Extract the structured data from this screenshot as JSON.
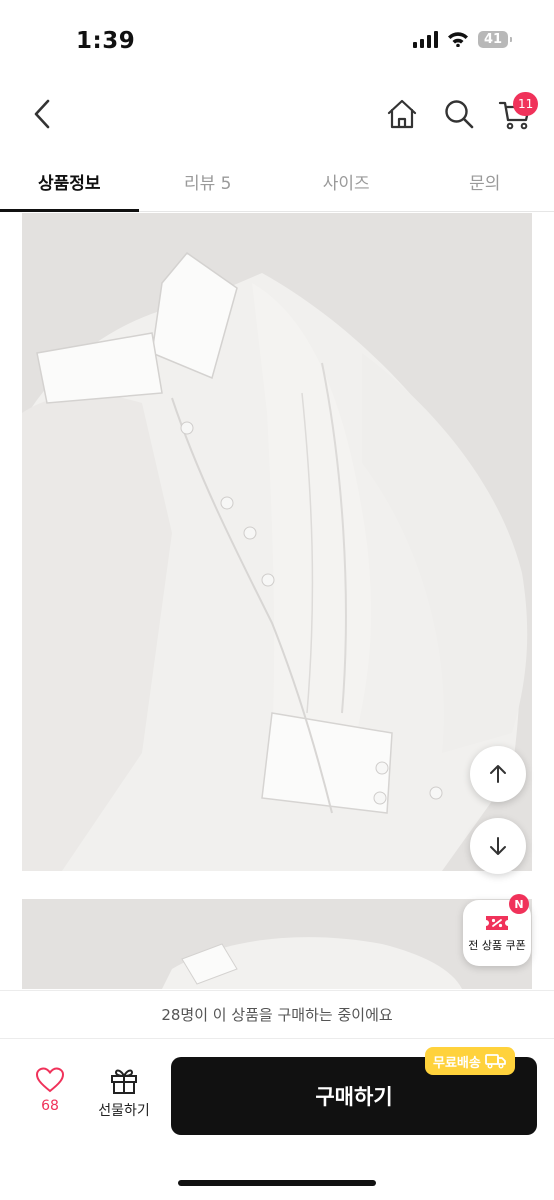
{
  "status_bar": {
    "time": "1:39",
    "battery": "41"
  },
  "header": {
    "cart_count": "11"
  },
  "tabs": [
    {
      "label": "상품정보",
      "active": true
    },
    {
      "label": "리뷰 5",
      "active": false
    },
    {
      "label": "사이즈",
      "active": false
    },
    {
      "label": "문의",
      "active": false
    }
  ],
  "coupon": {
    "label": "전 상품 쿠폰",
    "badge": "N"
  },
  "purchase_banner": "28명이 이 상품을 구매하는 중이에요",
  "bottom_bar": {
    "like_count": "68",
    "gift_label": "선물하기",
    "buy_label": "구매하기",
    "free_shipping_label": "무료배송"
  },
  "colors": {
    "accent": "#f0325a",
    "buy_button": "#111111",
    "free_shipping": "#ffd23c"
  }
}
